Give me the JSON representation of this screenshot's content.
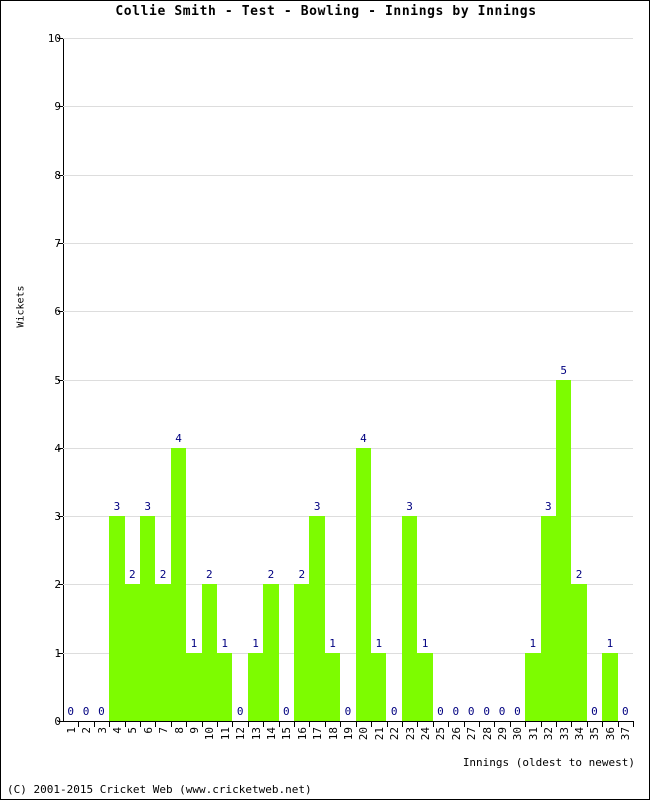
{
  "chart_data": {
    "type": "bar",
    "title": "Collie Smith - Test - Bowling - Innings by Innings",
    "xlabel": "Innings (oldest to newest)",
    "ylabel": "Wickets",
    "ylim": [
      0,
      10
    ],
    "ytick_labels": [
      "0",
      "1",
      "2",
      "3",
      "4",
      "5",
      "6",
      "7",
      "8",
      "9",
      "10"
    ],
    "grid": true,
    "legend": null,
    "bar_color": "#7dfc00",
    "value_label_color": "#000080",
    "categories": [
      "1",
      "2",
      "3",
      "4",
      "5",
      "6",
      "7",
      "8",
      "9",
      "10",
      "11",
      "12",
      "13",
      "14",
      "15",
      "16",
      "17",
      "18",
      "19",
      "20",
      "21",
      "22",
      "23",
      "24",
      "25",
      "26",
      "27",
      "28",
      "29",
      "30",
      "31",
      "32",
      "33",
      "34",
      "35",
      "36",
      "37"
    ],
    "values": [
      0,
      0,
      0,
      3,
      2,
      3,
      2,
      4,
      1,
      2,
      1,
      0,
      1,
      2,
      0,
      2,
      3,
      1,
      0,
      4,
      1,
      0,
      3,
      1,
      0,
      0,
      0,
      0,
      0,
      0,
      1,
      3,
      5,
      2,
      0,
      1,
      0
    ]
  },
  "footer": {
    "copyright": "(C) 2001-2015 Cricket Web (www.cricketweb.net)"
  }
}
